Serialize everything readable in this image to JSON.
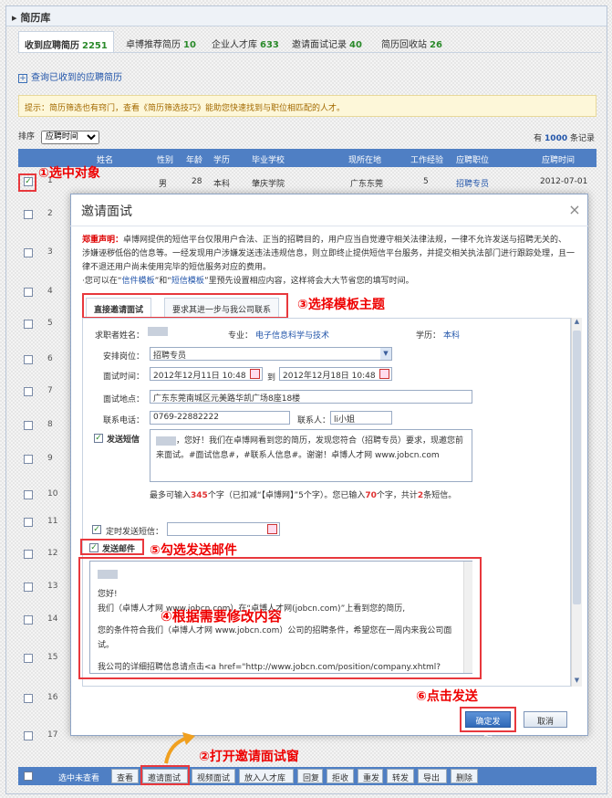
{
  "header": {
    "title": "简历库"
  },
  "tabs": [
    {
      "label": "收到应聘简历",
      "count": "2251"
    },
    {
      "label": "卓博推荐简历",
      "count": "10"
    },
    {
      "label": "企业人才库",
      "count": "633"
    },
    {
      "label": "邀请面试记录",
      "count": "40"
    },
    {
      "label": "简历回收站",
      "count": "26"
    }
  ],
  "query_link": "查询已收到的应聘简历",
  "tips": "提示：简历筛选也有窍门，查看《简历筛选技巧》能助您快速找到与职位相匹配的人才。",
  "sort": {
    "label": "排序",
    "value": "应聘时间",
    "total_prefix": "有",
    "total": "1000",
    "total_suffix": "条记录"
  },
  "table": {
    "headers": [
      "姓名",
      "性别",
      "年龄",
      "学历",
      "毕业学校",
      "现所在地",
      "工作经验",
      "应聘职位",
      "应聘时间"
    ],
    "first_row": {
      "num": "1",
      "sex": "男",
      "age": "28",
      "edu": "本科",
      "school": "肇庆学院",
      "loc": "广东东莞",
      "exp": "5",
      "job": "招聘专员",
      "date": "2012-07-01"
    },
    "row_numbers": [
      "1",
      "2",
      "3",
      "4",
      "5",
      "6",
      "7",
      "8",
      "9",
      "10",
      "11",
      "12",
      "13",
      "14",
      "15",
      "16",
      "17"
    ]
  },
  "dialog": {
    "title": "邀请面试",
    "close": "×",
    "notice_head": "郑重声明：",
    "notice_1": "卓博网提供的短信平台仅限用户合法、正当的招聘目的，用户应当自觉遵守相关法律法规，一律不允许发送与招聘无关的、涉嫌诬秽低俗的信息等。一经发现用户涉嫌发送违法违规信息，则立即终止提供短信平台服务，并提交相关执法部门进行跟踪处理，且一律不退还用户尚未使用完毕的短信服务对应的费用。",
    "notice_2_prefix": "·您可以在",
    "link_letter": "信件模板",
    "notice_and": "和",
    "link_sms": "短信模板",
    "notice_2_suffix": "里预先设置相应内容，这样将会大大节省您的填写时间。",
    "tabs": [
      "直接邀请面试",
      "要求其进一步与我公司联系"
    ],
    "form": {
      "applicant_label": "求职者姓名：",
      "major_label": "专业：",
      "major_value": "电子信息科学与技术",
      "edu_label": "学历：",
      "edu_value": "本科",
      "position_label": "安排岗位：",
      "position_value": "招聘专员",
      "time_label": "面试时间：",
      "time_from": "2012年12月11日 10:48",
      "time_to_label": "到",
      "time_to": "2012年12月18日 10:48",
      "place_label": "面试地点：",
      "place_value": "广东东莞南城区元美路华凯广场8座18楼",
      "phone_label": "联系电话：",
      "phone_value": "0769-22882222",
      "contact_label": "联系人：",
      "contact_value": "li小姐",
      "sms_label": "发送短信",
      "sms_text": "，您好！我们在卓博网看到您的简历，发现您符合（招聘专员）要求，现邀您前来面试。#面试信息#，#联系人信息#。谢谢！卓博人才网 www.jobcn.com",
      "sms_note_1": "最多可输入",
      "sms_max": "345",
      "sms_note_2": "个字（已扣减“【卓博网】”5个字）。您已输入",
      "sms_typed": "70",
      "sms_note_3": "个字，共计",
      "sms_count": "2",
      "sms_note_4": "条短信。",
      "timer_label": "定时发送短信：",
      "mail_label": "发送邮件",
      "mail_lines": [
        "您好!",
        "我们（卓博人才网 www.jobcn.com）在“卓博人才网(jobcn.com)”上看到您的简历,",
        "您的条件符合我们（卓博人才网 www.jobcn.com）公司的招聘条件，希望您在一周内来我公司面试。",
        "我公司的详细招聘信息请点击<a href=\"http://www.jobcn.com/position/company.xhtml?"
      ]
    },
    "confirm": "确定发送",
    "cancel": "取消"
  },
  "footer": {
    "select_unread": "选中未查看",
    "buttons": [
      "查看",
      "邀请面试",
      "视频面试",
      "放入人才库",
      "回复",
      "拒收",
      "重发",
      "转发",
      "导出",
      "删除"
    ]
  },
  "annotations": {
    "a1": "①选中对象",
    "a2": "②打开邀请面试窗",
    "a3": "③选择模板主题",
    "a4": "④根据需要修改内容",
    "a5": "⑤勾选发送邮件",
    "a6": "⑥点击发送"
  },
  "colors": {
    "accent": "#4f7fc4",
    "annotation": "#e00000",
    "highlight": "#e8383d"
  }
}
